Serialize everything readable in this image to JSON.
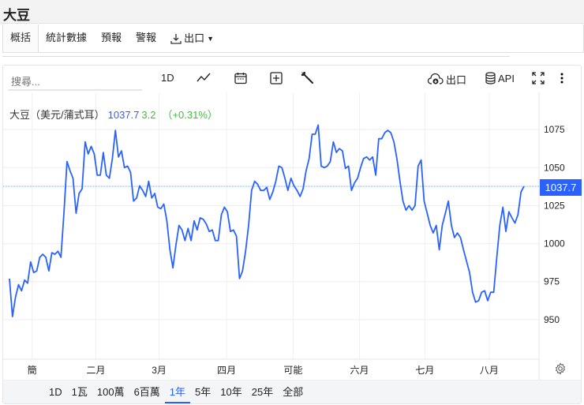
{
  "title": "大豆",
  "tabs": [
    {
      "label": "概括"
    },
    {
      "label": "統計數據"
    },
    {
      "label": "預報"
    },
    {
      "label": "警報"
    },
    {
      "label": "出口"
    }
  ],
  "toolbar": {
    "search_placeholder": "搜尋...",
    "interval": "1D",
    "export": "出口",
    "api": "API"
  },
  "legend": {
    "name": "大豆（美元/蒲式耳）",
    "price": "1037.7",
    "change": "3.2",
    "change_pct": "（+0.31%）"
  },
  "colors": {
    "line": "#2962ff",
    "up": "#3cbf3c",
    "accent": "#2962ff"
  },
  "ranges": [
    "1D",
    "1瓦",
    "100萬",
    "6百萬",
    "1年",
    "5年",
    "10年",
    "25年",
    "全部"
  ],
  "active_range": "1年",
  "chart_data": {
    "type": "line",
    "title": "大豆（美元/蒲式耳）",
    "last_price_label": "1037.7",
    "ylim": [
      925,
      1099.5
    ],
    "yticks": [
      {
        "v": 1075,
        "label": "1075"
      },
      {
        "v": 1050,
        "label": "1050"
      },
      {
        "v": 1025,
        "label": "1025"
      },
      {
        "v": 1000,
        "label": "1000"
      },
      {
        "v": 975,
        "label": "975"
      },
      {
        "v": 950,
        "label": "950"
      }
    ],
    "xticks": [
      {
        "pos": 0.054,
        "label": "簡"
      },
      {
        "pos": 0.173,
        "label": "二月"
      },
      {
        "pos": 0.291,
        "label": "3月"
      },
      {
        "pos": 0.417,
        "label": "四月"
      },
      {
        "pos": 0.541,
        "label": "可能"
      },
      {
        "pos": 0.665,
        "label": "六月"
      },
      {
        "pos": 0.787,
        "label": "七月"
      },
      {
        "pos": 0.907,
        "label": "八月"
      }
    ],
    "values": [
      977,
      952,
      965,
      973,
      969,
      976,
      974,
      988,
      981,
      982,
      991,
      993,
      991,
      982,
      994,
      993,
      995,
      991,
      1020,
      1054,
      1048,
      1043,
      1020,
      1033,
      1036,
      1067,
      1059,
      1064,
      1059,
      1045,
      1045,
      1060,
      1045,
      1043,
      1056,
      1074.5,
      1057,
      1061,
      1050,
      1051,
      1047,
      1028,
      1030,
      1038,
      1035,
      1031,
      1041,
      1030,
      1033,
      1024,
      1023,
      1026,
      1015,
      996,
      984,
      999,
      1012,
      1009,
      1002,
      1010,
      1002,
      1015,
      1009,
      1017,
      1016,
      1013,
      1008,
      1009,
      1002,
      1002,
      1019,
      1024,
      1021,
      1008,
      1009,
      1005,
      977,
      982,
      995,
      1012,
      1035,
      1041,
      1039,
      1035,
      1035,
      1037,
      1029,
      1034,
      1041,
      1051,
      1050,
      1043,
      1035,
      1043,
      1038,
      1035,
      1031,
      1036,
      1048,
      1056,
      1072,
      1072,
      1078,
      1051,
      1050,
      1051,
      1054,
      1067,
      1060,
      1062.5,
      1061,
      1049.5,
      1051,
      1035,
      1040,
      1043,
      1050,
      1056,
      1057,
      1055,
      1057,
      1045,
      1069,
      1069,
      1073,
      1074.5,
      1073,
      1067,
      1056,
      1041,
      1028,
      1022,
      1025,
      1022,
      1025,
      1051,
      1055,
      1028,
      1020,
      1012,
      1007,
      1012,
      996,
      1012,
      1020,
      1028,
      1012,
      1004,
      1007,
      1004,
      996,
      988.5,
      981,
      968,
      961.5,
      962.5,
      968,
      969,
      962.5,
      968,
      968,
      991,
      1012,
      1024,
      1008,
      1021,
      1017,
      1013.5,
      1019,
      1034,
      1037.7
    ]
  }
}
